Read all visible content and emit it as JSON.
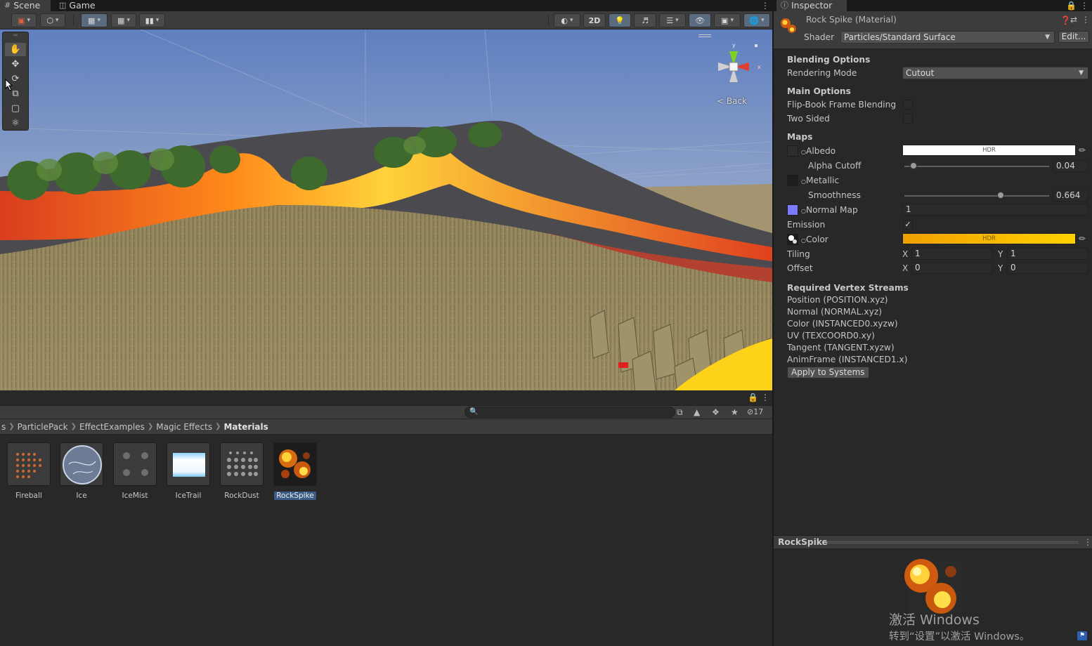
{
  "tabs": {
    "scene": "Scene",
    "game": "Game",
    "inspector": "Inspector"
  },
  "scene_toolbar": {
    "mode_2d": "2D"
  },
  "gizmo": {
    "axis_y": "y",
    "axis_x": "x",
    "view_label": "< Back"
  },
  "project": {
    "search_placeholder": "",
    "hidden_count": "17",
    "breadcrumb": [
      "s",
      "ParticlePack",
      "EffectExamples",
      "Magic Effects",
      "Materials"
    ],
    "assets": [
      {
        "name": "Fireball"
      },
      {
        "name": "Ice"
      },
      {
        "name": "IceMist"
      },
      {
        "name": "IceTrail"
      },
      {
        "name": "RockDust"
      },
      {
        "name": "RockSpike"
      }
    ]
  },
  "inspector": {
    "title": "Rock Spike (Material)",
    "shader_label": "Shader",
    "shader_value": "Particles/Standard Surface",
    "edit_button": "Edit...",
    "blending_header": "Blending Options",
    "rendering_mode_label": "Rendering Mode",
    "rendering_mode_value": "Cutout",
    "main_header": "Main Options",
    "flipbook_label": "Flip-Book Frame Blending",
    "two_sided_label": "Two Sided",
    "maps_header": "Maps",
    "albedo_label": "Albedo",
    "hdr_tag": "HDR",
    "alpha_cutoff_label": "Alpha Cutoff",
    "alpha_cutoff_value": "0.04",
    "alpha_cutoff_fraction": 0.04,
    "metallic_label": "Metallic",
    "smoothness_label": "Smoothness",
    "smoothness_value": "0.664",
    "smoothness_fraction": 0.664,
    "normal_map_label": "Normal Map",
    "normal_map_value": "1",
    "emission_label": "Emission",
    "color_label": "Color",
    "tiling_label": "Tiling",
    "offset_label": "Offset",
    "x": "X",
    "y": "Y",
    "tiling_x": "1",
    "tiling_y": "1",
    "offset_x": "0",
    "offset_y": "0",
    "streams_header": "Required Vertex Streams",
    "streams": [
      "Position (POSITION.xyz)",
      "Normal (NORMAL.xyz)",
      "Color (INSTANCED0.xyzw)",
      "UV (TEXCOORD0.xy)",
      "Tangent (TANGENT.xyzw)",
      "AnimFrame (INSTANCED1.x)"
    ],
    "apply_button": "Apply to Systems",
    "preview_title": "RockSpike"
  },
  "colors": {
    "albedo": "#ffffff",
    "emission_start": "#f0a000",
    "emission_end": "#ffd200",
    "normal_swatch": "#7b7bff",
    "selection": "#3d5b87"
  },
  "watermark": {
    "line1": "激活 Windows",
    "line2": "转到“设置”以激活 Windows。"
  }
}
